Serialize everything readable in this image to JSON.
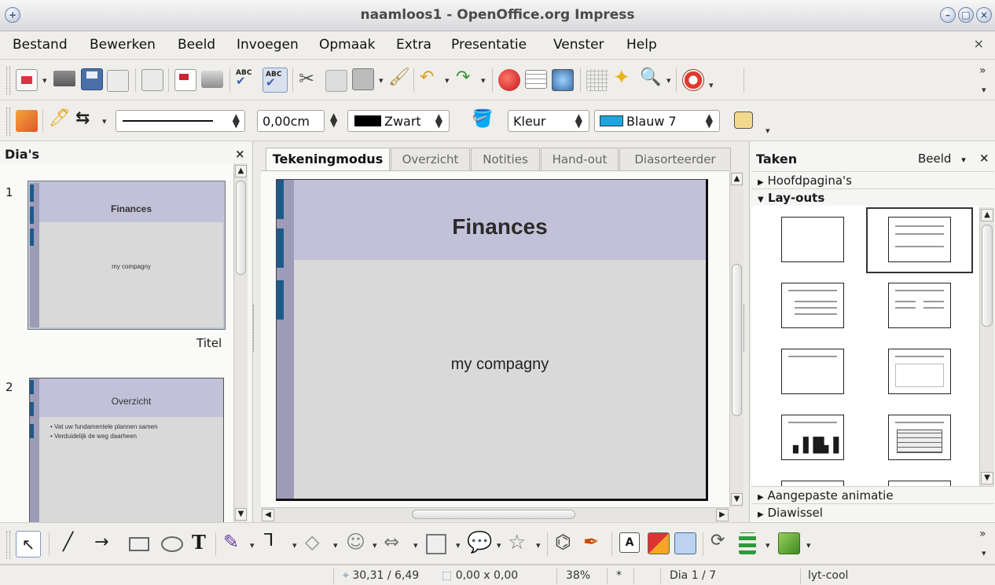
{
  "window": {
    "title": "naamloos1 - OpenOffice.org Impress"
  },
  "menubar": {
    "items": [
      "Bestand",
      "Bewerken",
      "Beeld",
      "Invoegen",
      "Opmaak",
      "Extra",
      "Presentatie",
      "Venster",
      "Help"
    ]
  },
  "line_toolbar": {
    "line_width": "0,00cm",
    "line_color": "Zwart",
    "line_color_hex": "#000000",
    "fill_style": "Kleur",
    "fill_color": "Blauw 7",
    "fill_color_hex": "#1aa7df"
  },
  "slides_panel": {
    "title": "Dia's",
    "slides": [
      {
        "number": "1",
        "title": "Finances",
        "subtitle": "my compagny",
        "layout_name": "Titel"
      },
      {
        "number": "2",
        "title": "Overzicht",
        "bullets": [
          "Vat uw fundamentele plannen samen",
          "Verduidelijk de weg daarheen"
        ]
      }
    ]
  },
  "view_tabs": [
    "Tekeningmodus",
    "Overzicht",
    "Notities",
    "Hand-out",
    "Diasorteerder"
  ],
  "active_tab": "Tekeningmodus",
  "slide": {
    "title": "Finances",
    "subtitle": "my compagny"
  },
  "tasks_panel": {
    "title": "Taken",
    "view_menu": "Beeld",
    "sections": [
      {
        "label": "Hoofdpagina's",
        "expanded": false
      },
      {
        "label": "Lay-outs",
        "expanded": true
      },
      {
        "label": "Aangepaste animatie",
        "expanded": false
      },
      {
        "label": "Diawissel",
        "expanded": false
      }
    ]
  },
  "statusbar": {
    "position": "30,31 / 6,49",
    "size": "0,00 x 0,00",
    "zoom": "38%",
    "modified": "*",
    "slide": "Dia 1 / 7",
    "layout": "lyt-cool"
  },
  "colors": {
    "accent_slide_header": "#c2c1d9",
    "slide_marker": "#1d5a8a",
    "slide_left_band": "#9d9bb8"
  }
}
